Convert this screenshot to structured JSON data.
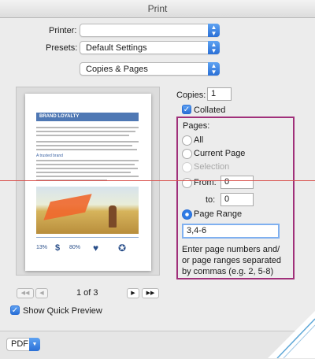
{
  "window": {
    "title": "Print"
  },
  "printer": {
    "label": "Printer:",
    "value": ""
  },
  "presets": {
    "label": "Presets:",
    "value": "Default Settings"
  },
  "section": {
    "value": "Copies & Pages"
  },
  "preview": {
    "heading": "BRAND LOYALTY",
    "subheading": "A trusted brand",
    "stat_1": "13%",
    "stat_2": "80%"
  },
  "copies": {
    "label": "Copies:",
    "value": "1",
    "collated_label": "Collated",
    "collated_checked": true
  },
  "pages": {
    "title": "Pages:",
    "all_label": "All",
    "current_label": "Current Page",
    "selection_label": "Selection",
    "from_label": "From:",
    "from_value": "0",
    "to_label": "to:",
    "to_value": "0",
    "range_label": "Page Range",
    "range_value": "3,4-6",
    "selected": "Page Range",
    "help_text": "Enter page numbers and/ or page ranges separated by commas (e.g. 2, 5-8)"
  },
  "navigation": {
    "page_indicator": "1 of 3"
  },
  "quick_preview": {
    "label": "Show Quick Preview",
    "checked": true
  },
  "bottom": {
    "pdf_label": "PDF"
  },
  "colors": {
    "accent": "#2f7be5",
    "highlight_box": "#a0307a",
    "guide_line": "#d9534f"
  }
}
